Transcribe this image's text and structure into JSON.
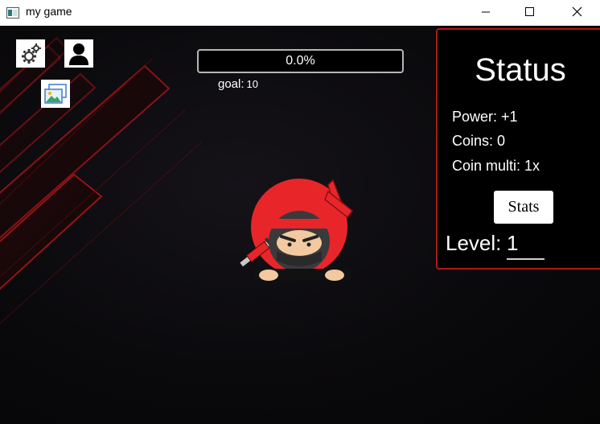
{
  "window": {
    "title": "my game",
    "app_icon": "window-app-icon",
    "controls": [
      "minimize-icon",
      "maximize-icon",
      "close-icon"
    ]
  },
  "toolbar": {
    "settings_icon": "gears-icon",
    "profile_icon": "user-icon",
    "gallery_icon": "image-icon"
  },
  "progress": {
    "text": "0.0%",
    "fraction": 0.0,
    "goal_label": "goal:",
    "goal_value": "10"
  },
  "character": "ninja-icon",
  "status": {
    "title": "Status",
    "power": "Power: +1",
    "coins": "Coins: 0",
    "coin_multi": "Coin multi: 1x",
    "stats_button": "Stats",
    "level_label": "Level:",
    "level_value": "1"
  },
  "colors": {
    "accent_red": "#e8262a",
    "panel_border": "#b01818",
    "background": "#0a090c"
  }
}
